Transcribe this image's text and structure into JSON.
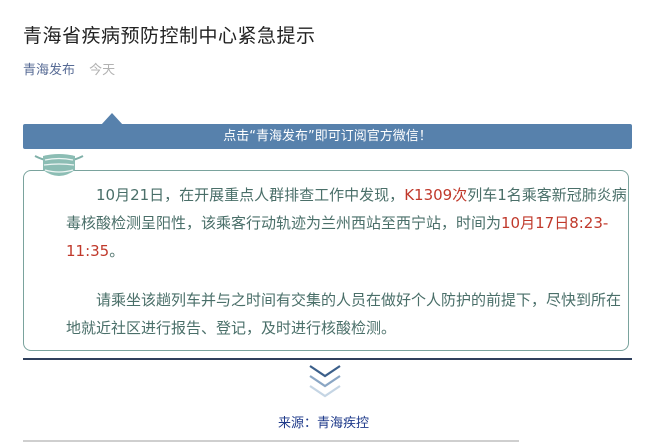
{
  "article": {
    "title": "青海省疾病预防控制中心紧急提示",
    "author": "青海发布",
    "date": "今天"
  },
  "banner": {
    "text": "点击“青海发布”即可订阅官方微信！"
  },
  "notice": {
    "p1_a": "10月21日，在开展重点人群排查工作中发现，",
    "p1_train": "K1309次",
    "p1_b": "列车1名乘客新冠肺炎病毒核酸检测呈阳性，该乘客行动轨迹为兰州西站至西宁站，时间为",
    "p1_time": "10月17日8:23-11:35",
    "p1_c": "。",
    "p2": "请乘坐该趟列车并与之时间有交集的人员在做好个人防护的前提下，尽快到所在地就近社区进行报告、登记，及时进行核酸检测。"
  },
  "footer": {
    "source": "来源：青海疾控"
  },
  "icons": {
    "mask": "mask-icon",
    "chevrons": "chevron-down-icon"
  },
  "colors": {
    "banner": "#5781ac",
    "highlight": "#c0392b",
    "notice_text": "#4a6f69",
    "border": "#7aa39d",
    "author_link": "#576b95"
  }
}
